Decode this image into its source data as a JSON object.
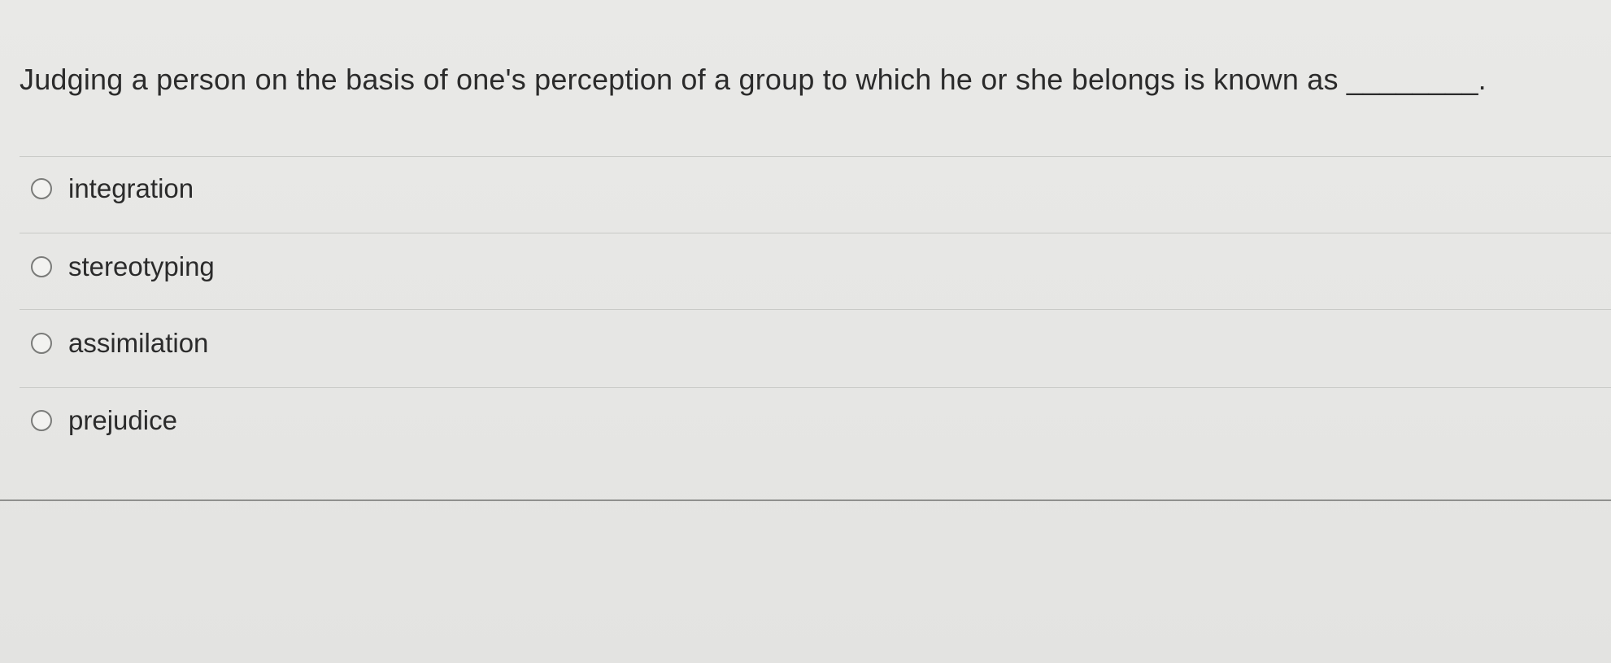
{
  "question": {
    "text": "Judging a person on the basis of one's perception of a group to which he or she belongs is known as ________."
  },
  "options": [
    {
      "label": "integration",
      "selected": false
    },
    {
      "label": "stereotyping",
      "selected": false
    },
    {
      "label": "assimilation",
      "selected": false
    },
    {
      "label": "prejudice",
      "selected": false
    }
  ]
}
